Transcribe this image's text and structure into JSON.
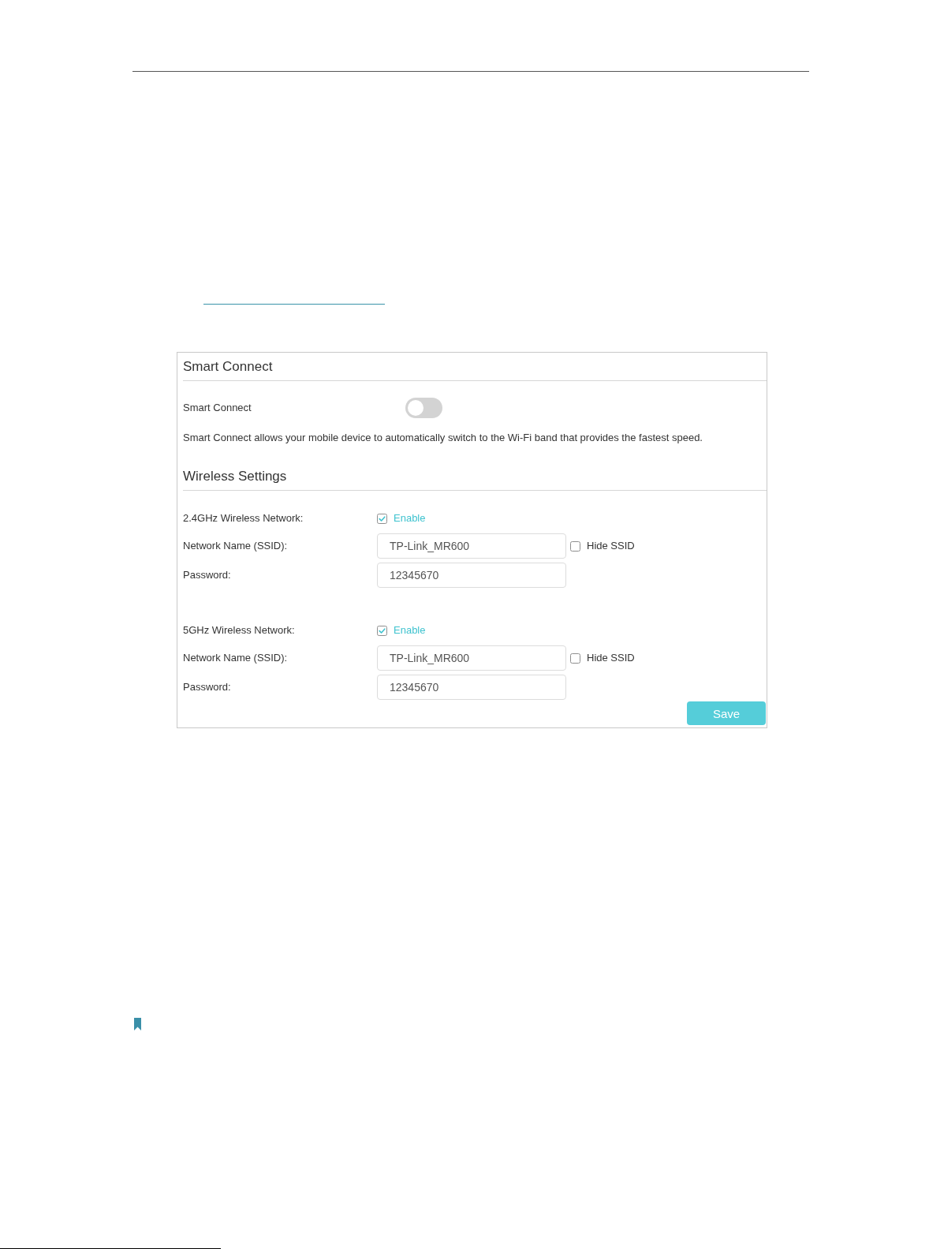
{
  "smart_connect": {
    "title": "Smart Connect",
    "label": "Smart Connect",
    "on": false,
    "description": "Smart Connect allows your mobile device to automatically switch to the Wi-Fi band that provides the fastest speed."
  },
  "wireless_settings": {
    "title": "Wireless Settings",
    "networks": [
      {
        "label": "2.4GHz Wireless Network:",
        "enable": {
          "label": "Enable",
          "checked": true
        },
        "ssid": {
          "label": "Network Name (SSID):",
          "value": "TP-Link_MR600"
        },
        "hide_ssid": {
          "label": "Hide SSID",
          "checked": false
        },
        "password": {
          "label": "Password:",
          "value": "12345670"
        }
      },
      {
        "label": "5GHz Wireless Network:",
        "enable": {
          "label": "Enable",
          "checked": true
        },
        "ssid": {
          "label": "Network Name (SSID):",
          "value": "TP-Link_MR600"
        },
        "hide_ssid": {
          "label": "Hide SSID",
          "checked": false
        },
        "password": {
          "label": "Password:",
          "value": "12345670"
        }
      }
    ]
  },
  "buttons": [
    {
      "label": "Save"
    }
  ]
}
